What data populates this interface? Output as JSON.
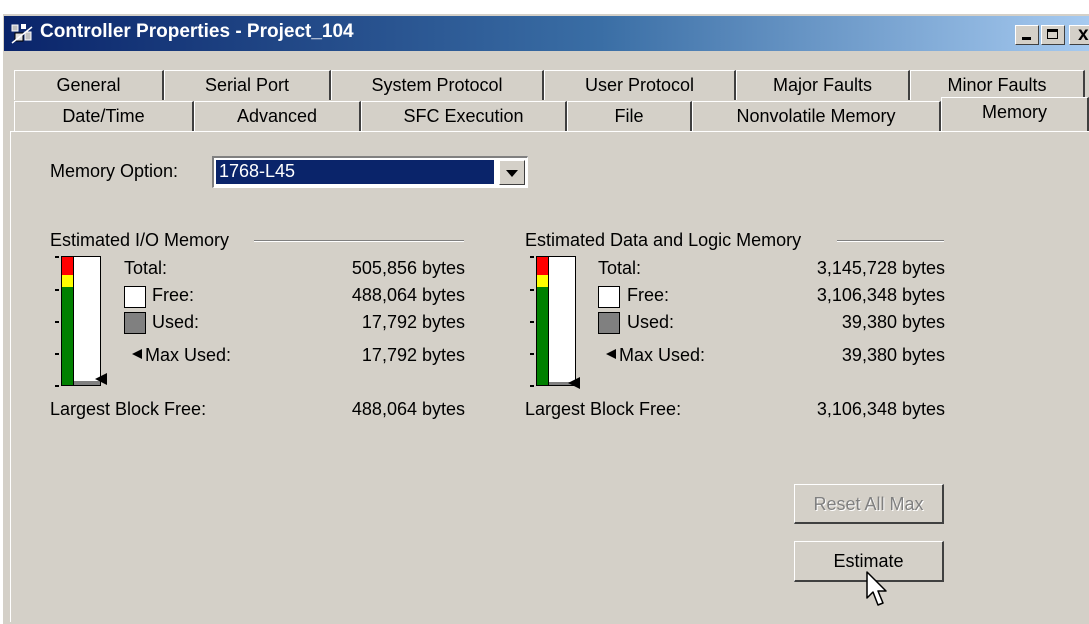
{
  "window": {
    "title": "Controller Properties - Project_104",
    "controls": [
      "minimize",
      "maximize",
      "close"
    ],
    "close_label": "x"
  },
  "tabs": {
    "row1": [
      "General",
      "Serial Port",
      "System Protocol",
      "User Protocol",
      "Major Faults",
      "Minor Faults"
    ],
    "row2": [
      "Date/Time",
      "Advanced",
      "SFC Execution",
      "File",
      "Nonvolatile Memory",
      "Memory"
    ],
    "active": "Memory"
  },
  "memory_option": {
    "label": "Memory Option:",
    "value": "1768-L45"
  },
  "io_memory": {
    "heading": "Estimated I/O Memory",
    "total_label": "Total:",
    "total_value": "505,856 bytes",
    "free_label": "Free:",
    "free_value": "488,064 bytes",
    "used_label": "Used:",
    "used_value": "17,792 bytes",
    "max_used_label": "Max Used:",
    "max_used_value": "17,792 bytes",
    "largest_block_label": "Largest Block Free:",
    "largest_block_value": "488,064 bytes",
    "used_fraction": 0.035
  },
  "data_logic_memory": {
    "heading": "Estimated Data and Logic Memory",
    "total_label": "Total:",
    "total_value": "3,145,728 bytes",
    "free_label": "Free:",
    "free_value": "3,106,348 bytes",
    "used_label": "Used:",
    "used_value": "39,380 bytes",
    "max_used_label": "Max Used:",
    "max_used_value": "39,380 bytes",
    "largest_block_label": "Largest Block Free:",
    "largest_block_value": "3,106,348 bytes",
    "used_fraction": 0.0125
  },
  "buttons": {
    "reset_all_max": "Reset All Max",
    "estimate": "Estimate"
  },
  "colors": {
    "title_gradient_start": "#0a246a",
    "title_gradient_end": "#a6caf0",
    "dialog_face": "#d4d0c8",
    "gauge_red": "#ff0000",
    "gauge_yellow": "#ffff00",
    "gauge_green": "#008000",
    "used_swatch": "#808080",
    "selection": "#0a246a"
  }
}
